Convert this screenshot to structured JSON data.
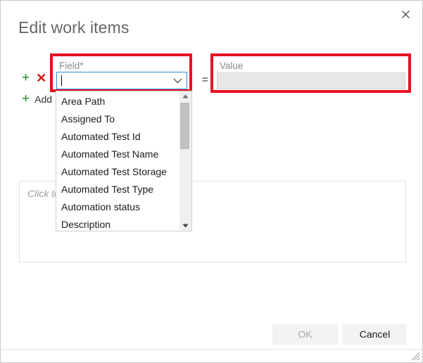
{
  "dialog": {
    "title": "Edit work items",
    "close_icon": "close-icon"
  },
  "clause_row": {
    "add_icon": "plus-icon",
    "remove_icon": "cross-icon",
    "add_clause_icon": "plus-icon",
    "add_clause_label": "Add",
    "operator": "="
  },
  "field_group": {
    "label": "Field*",
    "value": "",
    "chevron_icon": "chevron-down-icon"
  },
  "value_group": {
    "label": "Value",
    "value": "",
    "disabled": true
  },
  "dropdown": {
    "items": [
      "Area Path",
      "Assigned To",
      "Automated Test Id",
      "Automated Test Name",
      "Automated Test Storage",
      "Automated Test Type",
      "Automation status",
      "Description"
    ],
    "scroll_up_icon": "triangle-up-icon",
    "scroll_down_icon": "triangle-down-icon"
  },
  "query_area": {
    "placeholder": "Click to"
  },
  "footer": {
    "ok_label": "OK",
    "cancel_label": "Cancel",
    "resize_grip_icon": "resize-grip-icon"
  },
  "colors": {
    "highlight": "#e81123",
    "focus_border": "#2a8fd4",
    "add_icon": "#1a8a1a",
    "remove_icon": "#e01010"
  }
}
